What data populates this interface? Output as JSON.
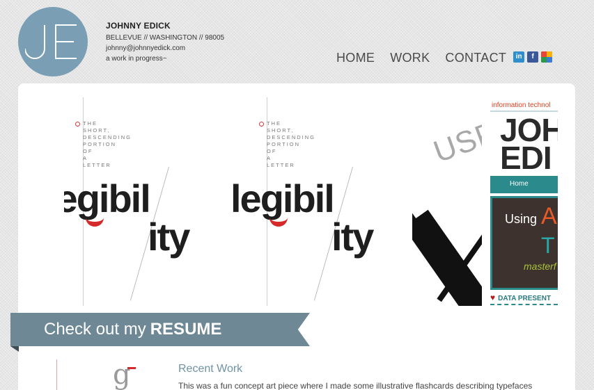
{
  "logo": {
    "initials": "JE",
    "color": "#7a9fb5"
  },
  "contact": {
    "name": "JOHNNY EDICK",
    "location": "BELLEVUE // WASHINGTON // 98005",
    "email": "johnny@johnnyedick.com",
    "tagline": "a work in progress~"
  },
  "nav": {
    "items": [
      "HOME",
      "WORK",
      "CONTACT"
    ],
    "social": [
      {
        "icon": "linkedin-icon",
        "label": "in"
      },
      {
        "icon": "facebook-icon",
        "label": "f"
      },
      {
        "icon": "google-plus-icon",
        "label": ""
      }
    ]
  },
  "slider": {
    "panels": [
      {
        "desc": "THE\nSHORT,\nDESCENDING\nPORTION\nOF\nA\nLETTER",
        "word_top": "legibil",
        "word_bot": "ity"
      },
      {
        "desc": "THE\nSHORT,\nDESCENDING\nPORTION\nOF\nA\nLETTER",
        "word_top": "legibil",
        "word_bot": "ity"
      }
    ],
    "usp_text": "USP",
    "site_preview": {
      "top_label": "information technol",
      "name_line1": "JOH",
      "name_line2": "EDI",
      "nav_home": "Home",
      "using": "Using",
      "ap": "AP",
      "t": "T",
      "master": "masterf",
      "data": "DATA PRESENT"
    }
  },
  "resume_banner": {
    "prefix": "Check out my",
    "strong": "RESUME"
  },
  "recent_work": {
    "title": "Recent Work",
    "body": "This was a fun concept art piece where I made some illustrative flashcards describing typefaces"
  },
  "colors": {
    "accent": "#6e8896",
    "brand": "#7a9fb5",
    "link": "#6e93a6",
    "red": "#d42a2a"
  }
}
